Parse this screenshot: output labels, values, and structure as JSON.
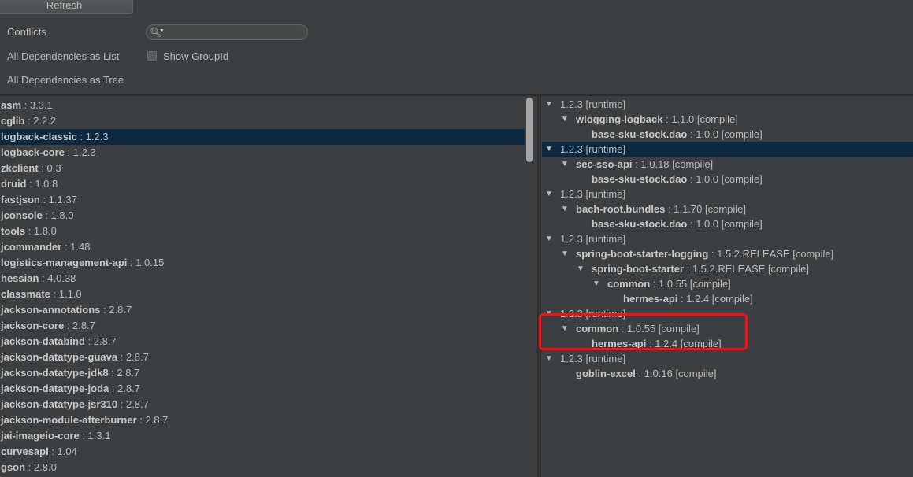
{
  "toolbar": {
    "refresh_label": "Refresh"
  },
  "view_modes": [
    {
      "label": "Conflicts"
    },
    {
      "label": "All Dependencies as List"
    },
    {
      "label": "All Dependencies as Tree"
    }
  ],
  "search": {
    "value": ""
  },
  "show_groupid": {
    "label": "Show GroupId",
    "checked": false
  },
  "dependency_list": [
    {
      "name": "asm",
      "version": " : 3.3.1"
    },
    {
      "name": "cglib",
      "version": " : 2.2.2"
    },
    {
      "name": "logback-classic",
      "version": " : 1.2.3",
      "selected": true
    },
    {
      "name": "logback-core",
      "version": " : 1.2.3"
    },
    {
      "name": "zkclient",
      "version": " : 0.3"
    },
    {
      "name": "druid",
      "version": " : 1.0.8"
    },
    {
      "name": "fastjson",
      "version": " : 1.1.37"
    },
    {
      "name": "jconsole",
      "version": " : 1.8.0"
    },
    {
      "name": "tools",
      "version": " : 1.8.0"
    },
    {
      "name": "jcommander",
      "version": " : 1.48"
    },
    {
      "name": "logistics-management-api",
      "version": " : 1.0.15"
    },
    {
      "name": "hessian",
      "version": " : 4.0.38"
    },
    {
      "name": "classmate",
      "version": " : 1.1.0"
    },
    {
      "name": "jackson-annotations",
      "version": " : 2.8.7"
    },
    {
      "name": "jackson-core",
      "version": " : 2.8.7"
    },
    {
      "name": "jackson-databind",
      "version": " : 2.8.7"
    },
    {
      "name": "jackson-datatype-guava",
      "version": " : 2.8.7"
    },
    {
      "name": "jackson-datatype-jdk8",
      "version": " : 2.8.7"
    },
    {
      "name": "jackson-datatype-joda",
      "version": " : 2.8.7"
    },
    {
      "name": "jackson-datatype-jsr310",
      "version": " : 2.8.7"
    },
    {
      "name": "jackson-module-afterburner",
      "version": " : 2.8.7"
    },
    {
      "name": "jai-imageio-core",
      "version": " : 1.3.1"
    },
    {
      "name": "curvesapi",
      "version": " : 1.04"
    },
    {
      "name": "gson",
      "version": " : 2.8.0"
    }
  ],
  "usage_tree": [
    {
      "depth": 0,
      "expanded": true,
      "name": "",
      "version": "1.2.3 [runtime]"
    },
    {
      "depth": 1,
      "expanded": true,
      "name": "wlogging-logback",
      "version": " : 1.1.0 [compile]"
    },
    {
      "depth": 2,
      "expanded": null,
      "name": "base-sku-stock.dao",
      "version": " : 1.0.0 [compile]"
    },
    {
      "depth": 0,
      "expanded": true,
      "name": "",
      "version": "1.2.3 [runtime]",
      "selected": true
    },
    {
      "depth": 1,
      "expanded": true,
      "name": "sec-sso-api",
      "version": " : 1.0.18 [compile]"
    },
    {
      "depth": 2,
      "expanded": null,
      "name": "base-sku-stock.dao",
      "version": " : 1.0.0 [compile]"
    },
    {
      "depth": 0,
      "expanded": true,
      "name": "",
      "version": "1.2.3 [runtime]"
    },
    {
      "depth": 1,
      "expanded": true,
      "name": "bach-root.bundles",
      "version": " : 1.1.70 [compile]"
    },
    {
      "depth": 2,
      "expanded": null,
      "name": "base-sku-stock.dao",
      "version": " : 1.0.0 [compile]"
    },
    {
      "depth": 0,
      "expanded": true,
      "name": "",
      "version": "1.2.3 [runtime]"
    },
    {
      "depth": 1,
      "expanded": true,
      "name": "spring-boot-starter-logging",
      "version": " : 1.5.2.RELEASE [compile]"
    },
    {
      "depth": 2,
      "expanded": true,
      "name": "spring-boot-starter",
      "version": " : 1.5.2.RELEASE [compile]"
    },
    {
      "depth": 3,
      "expanded": true,
      "name": "common",
      "version": " : 1.0.55 [compile]"
    },
    {
      "depth": 4,
      "expanded": null,
      "name": "hermes-api",
      "version": " : 1.2.4 [compile]"
    },
    {
      "depth": 0,
      "expanded": true,
      "name": "",
      "version": "1.2.3 [runtime]"
    },
    {
      "depth": 1,
      "expanded": true,
      "name": "common",
      "version": " : 1.0.55 [compile]"
    },
    {
      "depth": 2,
      "expanded": null,
      "name": "hermes-api",
      "version": " : 1.2.4 [compile]"
    },
    {
      "depth": 0,
      "expanded": true,
      "name": "",
      "version": "1.2.3 [runtime]"
    },
    {
      "depth": 1,
      "expanded": null,
      "name": "goblin-excel",
      "version": " : 1.0.16 [compile]"
    }
  ],
  "colors": {
    "selection": "#0d293e",
    "highlight_box": "#e0191f",
    "background": "#3c3f41"
  },
  "icons": {
    "search": "search-icon",
    "expanded": "triangle-down-icon"
  }
}
